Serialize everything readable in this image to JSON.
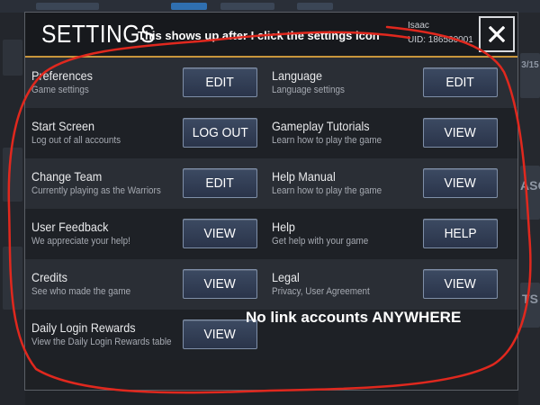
{
  "background": {
    "right_tiles": [
      "3/15",
      "ASO",
      "TS"
    ]
  },
  "header": {
    "title": "SETTINGS",
    "user_name": "Isaac",
    "uid": "UID: 186580001"
  },
  "annotations": {
    "top": "This shows up after I click the settings icon",
    "bottom": "No link accounts ANYWHERE",
    "markup_color": "#e0281e"
  },
  "rows": [
    {
      "left": {
        "title": "Preferences",
        "subtitle": "Game settings",
        "button": "EDIT"
      },
      "right": {
        "title": "Language",
        "subtitle": "Language settings",
        "button": "EDIT"
      }
    },
    {
      "left": {
        "title": "Start Screen",
        "subtitle": "Log out of all accounts",
        "button": "LOG OUT"
      },
      "right": {
        "title": "Gameplay Tutorials",
        "subtitle": "Learn how to play the game",
        "button": "VIEW"
      }
    },
    {
      "left": {
        "title": "Change Team",
        "subtitle": "Currently playing as the Warriors",
        "button": "EDIT"
      },
      "right": {
        "title": "Help Manual",
        "subtitle": "Learn how to play the game",
        "button": "VIEW"
      }
    },
    {
      "left": {
        "title": "User Feedback",
        "subtitle": "We appreciate your help!",
        "button": "VIEW"
      },
      "right": {
        "title": "Help",
        "subtitle": "Get help with your game",
        "button": "HELP"
      }
    },
    {
      "left": {
        "title": "Credits",
        "subtitle": "See who made the game",
        "button": "VIEW"
      },
      "right": {
        "title": "Legal",
        "subtitle": "Privacy, User Agreement",
        "button": "VIEW"
      }
    },
    {
      "left": {
        "title": "Daily Login Rewards",
        "subtitle": "View the Daily Login Rewards table",
        "button": "VIEW"
      }
    }
  ],
  "colors": {
    "accent_border": "#c8963c",
    "button_bg": "#33405a"
  }
}
